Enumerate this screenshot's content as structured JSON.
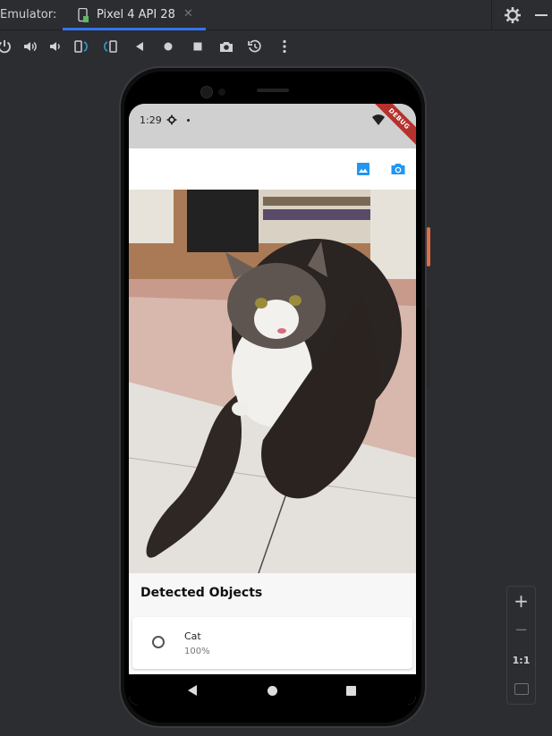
{
  "ide": {
    "tool_window_title": "Emulator:",
    "device_tab": {
      "label": "Pixel 4 API 28",
      "close": "✕"
    },
    "toolbar_icons": [
      "power-icon",
      "volume-up-icon",
      "volume-down-icon",
      "rotate-left-icon",
      "rotate-right-icon",
      "back-icon",
      "home-icon",
      "overview-icon",
      "screenshot-icon",
      "snapshot-icon",
      "more-icon"
    ],
    "zoom": {
      "zoom_in": "+",
      "zoom_out": "−",
      "actual_size": "1:1"
    },
    "accent_color": "#3574f0"
  },
  "device": {
    "status_bar": {
      "time": "1:29",
      "debug_banner": "DEBUG"
    },
    "app_bar": {
      "gallery_icon": "image-icon",
      "camera_icon": "camera-icon",
      "icon_color": "#2196f3"
    },
    "results": {
      "title": "Detected Objects",
      "items": [
        {
          "label": "Cat",
          "confidence": "100%"
        }
      ]
    }
  }
}
